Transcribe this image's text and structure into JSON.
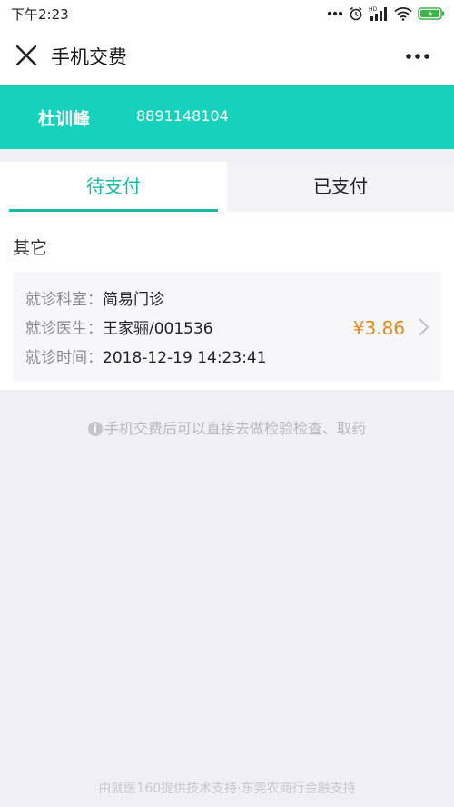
{
  "status_bar": {
    "time": "下午2:23",
    "icons": [
      "dots-icon",
      "alarm-icon",
      "hd-signal-icon",
      "wifi-icon",
      "battery-icon"
    ]
  },
  "nav": {
    "title": "手机交费",
    "close_icon": "close-icon",
    "more_icon": "more-icon"
  },
  "patient": {
    "name": "杜训峰",
    "id": "8891148104"
  },
  "tabs": [
    {
      "label": "待支付",
      "active": true
    },
    {
      "label": "已支付",
      "active": false
    }
  ],
  "section": {
    "title": "其它",
    "record": {
      "department_label": "就诊科室：",
      "department": "简易门诊",
      "doctor_label": "就诊医生：",
      "doctor": "王家骊/001536",
      "time_label": "就诊时间：",
      "time": "2018-12-19 14:23:41",
      "amount": "¥3.86"
    }
  },
  "notice": "手机交费后可以直接去做检验检查、取药",
  "footer": "由就医160提供技术支持·东莞农商行金融支持",
  "colors": {
    "accent": "#16d2bd",
    "tab_active": "#17b8a5",
    "amount": "#e08a1e",
    "background": "#f0eff4"
  }
}
